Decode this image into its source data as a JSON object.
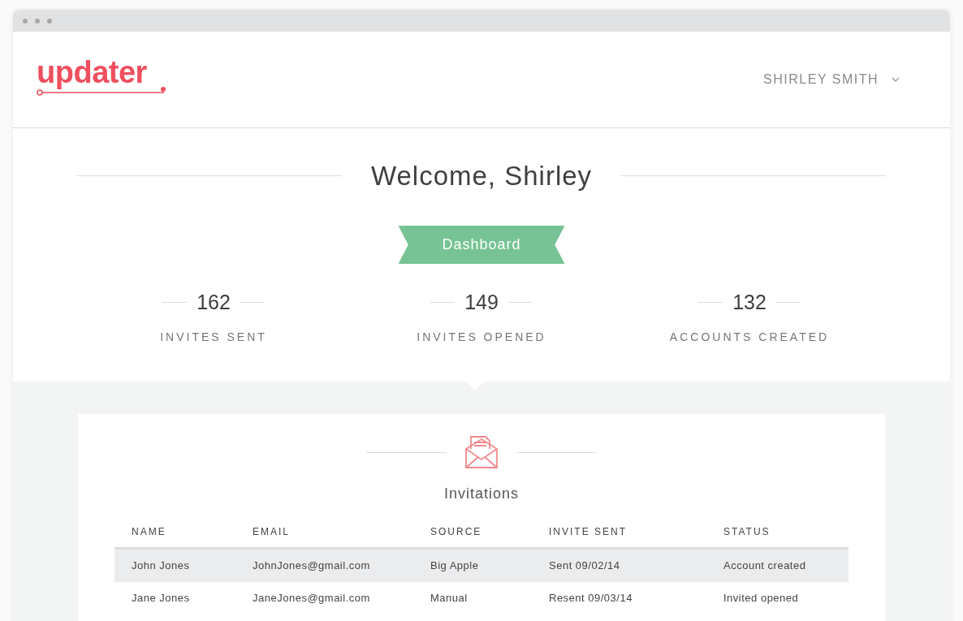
{
  "logo": {
    "text": "updater"
  },
  "user_menu": {
    "label": "SHIRLEY SMITH"
  },
  "welcome": {
    "title": "Welcome, Shirley"
  },
  "ribbon": {
    "label": "Dashboard"
  },
  "stats": [
    {
      "value": "162",
      "label": "INVITES SENT"
    },
    {
      "value": "149",
      "label": "INVITES OPENED"
    },
    {
      "value": "132",
      "label": "ACCOUNTS CREATED"
    }
  ],
  "invitations": {
    "title": "Invitations",
    "table": {
      "columns": [
        "NAME",
        "EMAIL",
        "SOURCE",
        "INVITE SENT",
        "STATUS"
      ],
      "rows": [
        {
          "selected": true,
          "cells": [
            "John Jones",
            "JohnJones@gmail.com",
            "Big Apple",
            "Sent 09/02/14",
            "Account created"
          ]
        },
        {
          "selected": false,
          "cells": [
            "Jane Jones",
            "JaneJones@gmail.com",
            "Manual",
            "Resent 09/03/14",
            "Invited opened"
          ]
        }
      ]
    }
  }
}
